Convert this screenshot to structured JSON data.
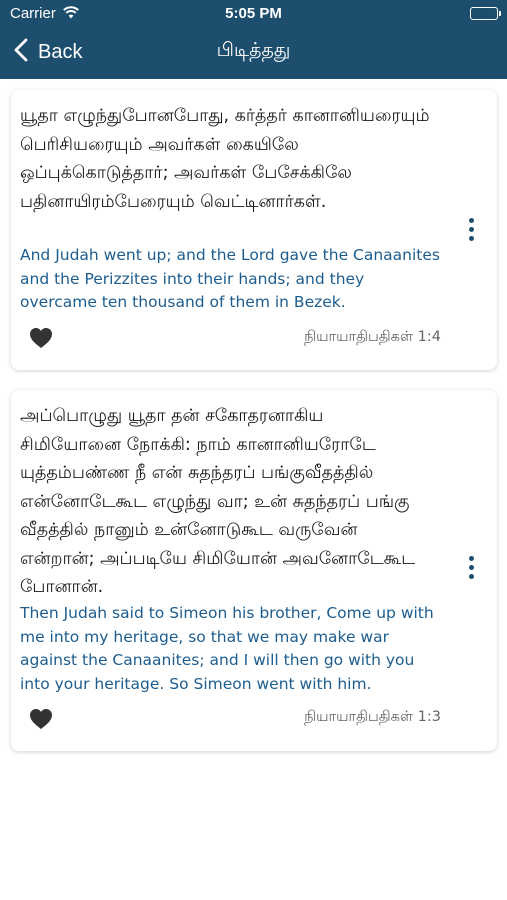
{
  "status_bar": {
    "carrier": "Carrier",
    "time": "5:05 PM"
  },
  "nav": {
    "back_label": "Back",
    "title": "பிடித்தது"
  },
  "favorites": [
    {
      "tamil": "யூதா எழுந்துபோனபோது, கர்த்தர் கானானியரையும் பெரிசியரையும் அவர்கள் கையிலே ஒப்புக்கொடுத்தார்; அவர்கள் பேசேக்கிலே பதினாயிரம்பேரையும் வெட்டினார்கள்.",
      "english": "And Judah went up; and the Lord gave the Canaanites and the Perizzites into their hands; and they overcame ten thousand of them in Bezek.",
      "reference": "நியாயாதிபதிகள் 1:4"
    },
    {
      "tamil": "அப்பொழுது யூதா தன் சகோதரனாகிய சிமியோனை நோக்கி: நாம் கானானியரோடே யுத்தம்பண்ண நீ என் சுதந்தரப் பங்குவீதத்தில் என்னோடேகூட எழுந்து வா; உன் சுதந்தரப் பங்கு வீதத்தில் நானும் உன்னோடுகூட வருவேன் என்றான்; அப்படியே சிமியோன் அவனோடேகூட போனான்.",
      "english": "Then Judah said to Simeon his brother, Come up with me into my heritage, so that we may make war against the Canaanites; and I will then go with you into your heritage. So Simeon went with him.",
      "reference": "நியாயாதிபதிகள் 1:3"
    }
  ],
  "colors": {
    "nav_background": "#1e4e6e",
    "english_text": "#1d5d8e",
    "reference_text": "#666666"
  }
}
